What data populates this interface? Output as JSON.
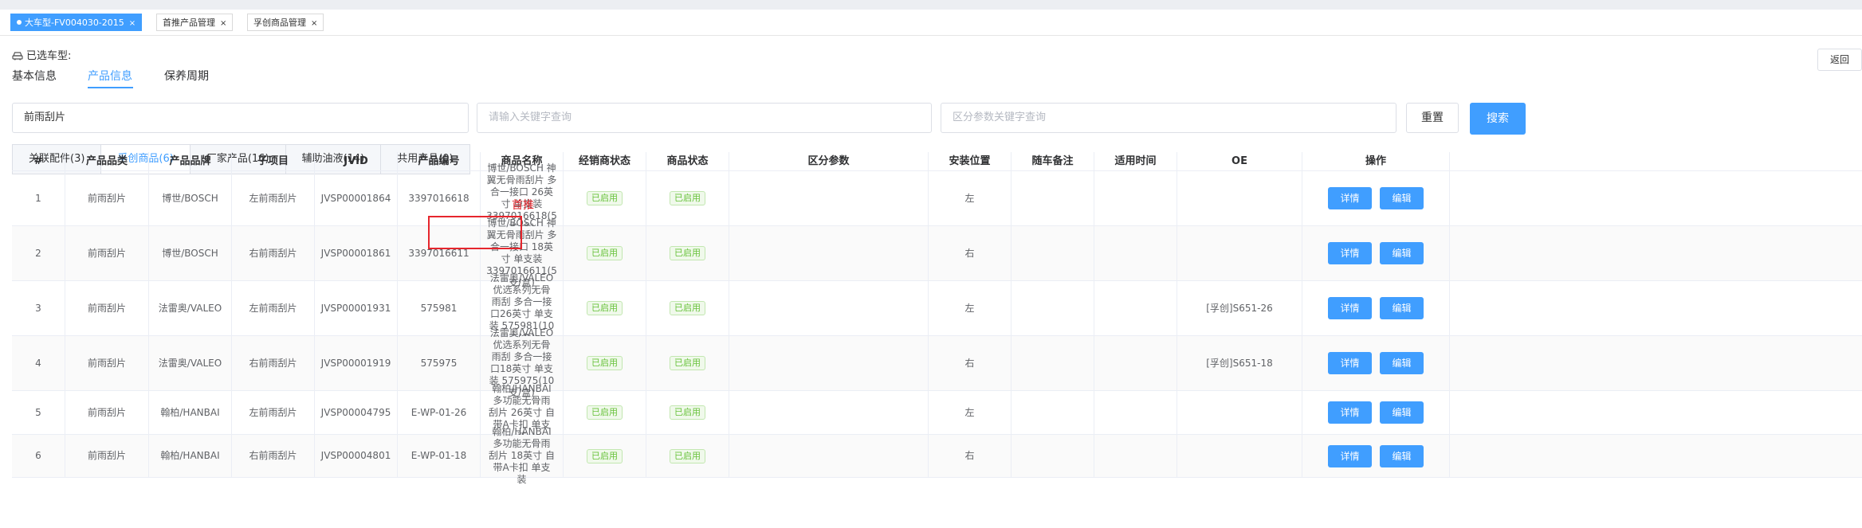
{
  "tabs": [
    {
      "label": "大车型-FV004030-2015",
      "active": true
    },
    {
      "label": "首推产品管理",
      "active": false
    },
    {
      "label": "孚创商品管理",
      "active": false
    }
  ],
  "close_glyph": "×",
  "selected_vehicle_label": "已选车型:",
  "back_label": "返回",
  "subtabs": [
    "基本信息",
    "产品信息",
    "保养周期"
  ],
  "filters": {
    "category_value": "前雨刮片",
    "keyword_placeholder": "请输入关键字查询",
    "param_placeholder": "区分参数关键字查询",
    "reset_label": "重置",
    "search_label": "搜索"
  },
  "product_tabs": [
    "关联配件(3)",
    "孚创商品(6)",
    "厂家产品(16)",
    "辅助油液(14)",
    "共用产品(0)"
  ],
  "highlight_label": "首推",
  "columns": [
    "#",
    "产品品类",
    "产品品牌",
    "子项目",
    "JVID",
    "产品编号",
    "商品名称",
    "经销商状态",
    "商品状态",
    "区分参数",
    "安装位置",
    "随车备注",
    "适用时间",
    "OE",
    "操作"
  ],
  "action_labels": {
    "detail": "详情",
    "edit": "编辑"
  },
  "rows": [
    {
      "no": "1",
      "category": "前雨刮片",
      "brand": "博世/BOSCH",
      "sub": "左前雨刮片",
      "jvid": "JVSP00001864",
      "code": "3397016618",
      "name": "博世/BOSCH 神翼无骨雨刮片 多合一接口 26英寸 单支装 3397016618(5支/盒)",
      "dealer_status": "已启用",
      "product_status": "已启用",
      "param": "",
      "position": "左",
      "remark": "",
      "time": "",
      "oe": ""
    },
    {
      "no": "2",
      "category": "前雨刮片",
      "brand": "博世/BOSCH",
      "sub": "右前雨刮片",
      "jvid": "JVSP00001861",
      "code": "3397016611",
      "name": "博世/BOSCH 神翼无骨雨刮片 多合一接口 18英寸 单支装 3397016611(5支/盒)",
      "dealer_status": "已启用",
      "product_status": "已启用",
      "param": "",
      "position": "右",
      "remark": "",
      "time": "",
      "oe": ""
    },
    {
      "no": "3",
      "category": "前雨刮片",
      "brand": "法雷奥/VALEO",
      "sub": "左前雨刮片",
      "jvid": "JVSP00001931",
      "code": "575981",
      "name": "法雷奥/VALEO 优选系列无骨雨刮 多合一接口26英寸 单支装 575981(10支/盒)",
      "dealer_status": "已启用",
      "product_status": "已启用",
      "param": "",
      "position": "左",
      "remark": "",
      "time": "",
      "oe": "[孚创]S651-26"
    },
    {
      "no": "4",
      "category": "前雨刮片",
      "brand": "法雷奥/VALEO",
      "sub": "右前雨刮片",
      "jvid": "JVSP00001919",
      "code": "575975",
      "name": "法雷奥/VALEO 优选系列无骨雨刮 多合一接口18英寸 单支装 575975(10支/盒)",
      "dealer_status": "已启用",
      "product_status": "已启用",
      "param": "",
      "position": "右",
      "remark": "",
      "time": "",
      "oe": "[孚创]S651-18"
    },
    {
      "no": "5",
      "category": "前雨刮片",
      "brand": "翰柏/HANBAI",
      "sub": "左前雨刮片",
      "jvid": "JVSP00004795",
      "code": "E-WP-01-26",
      "name": "翰柏/HANBAI 多功能无骨雨刮片 26英寸 自带A卡扣 单支装",
      "dealer_status": "已启用",
      "product_status": "已启用",
      "param": "",
      "position": "左",
      "remark": "",
      "time": "",
      "oe": ""
    },
    {
      "no": "6",
      "category": "前雨刮片",
      "brand": "翰柏/HANBAI",
      "sub": "右前雨刮片",
      "jvid": "JVSP00004801",
      "code": "E-WP-01-18",
      "name": "翰柏/HANBAI 多功能无骨雨刮片 18英寸 自带A卡扣 单支装",
      "dealer_status": "已启用",
      "product_status": "已启用",
      "param": "",
      "position": "右",
      "remark": "",
      "time": "",
      "oe": ""
    }
  ],
  "colors": {
    "primary": "#409eff",
    "success": "#67c23a",
    "highlight": "#e6262d"
  }
}
